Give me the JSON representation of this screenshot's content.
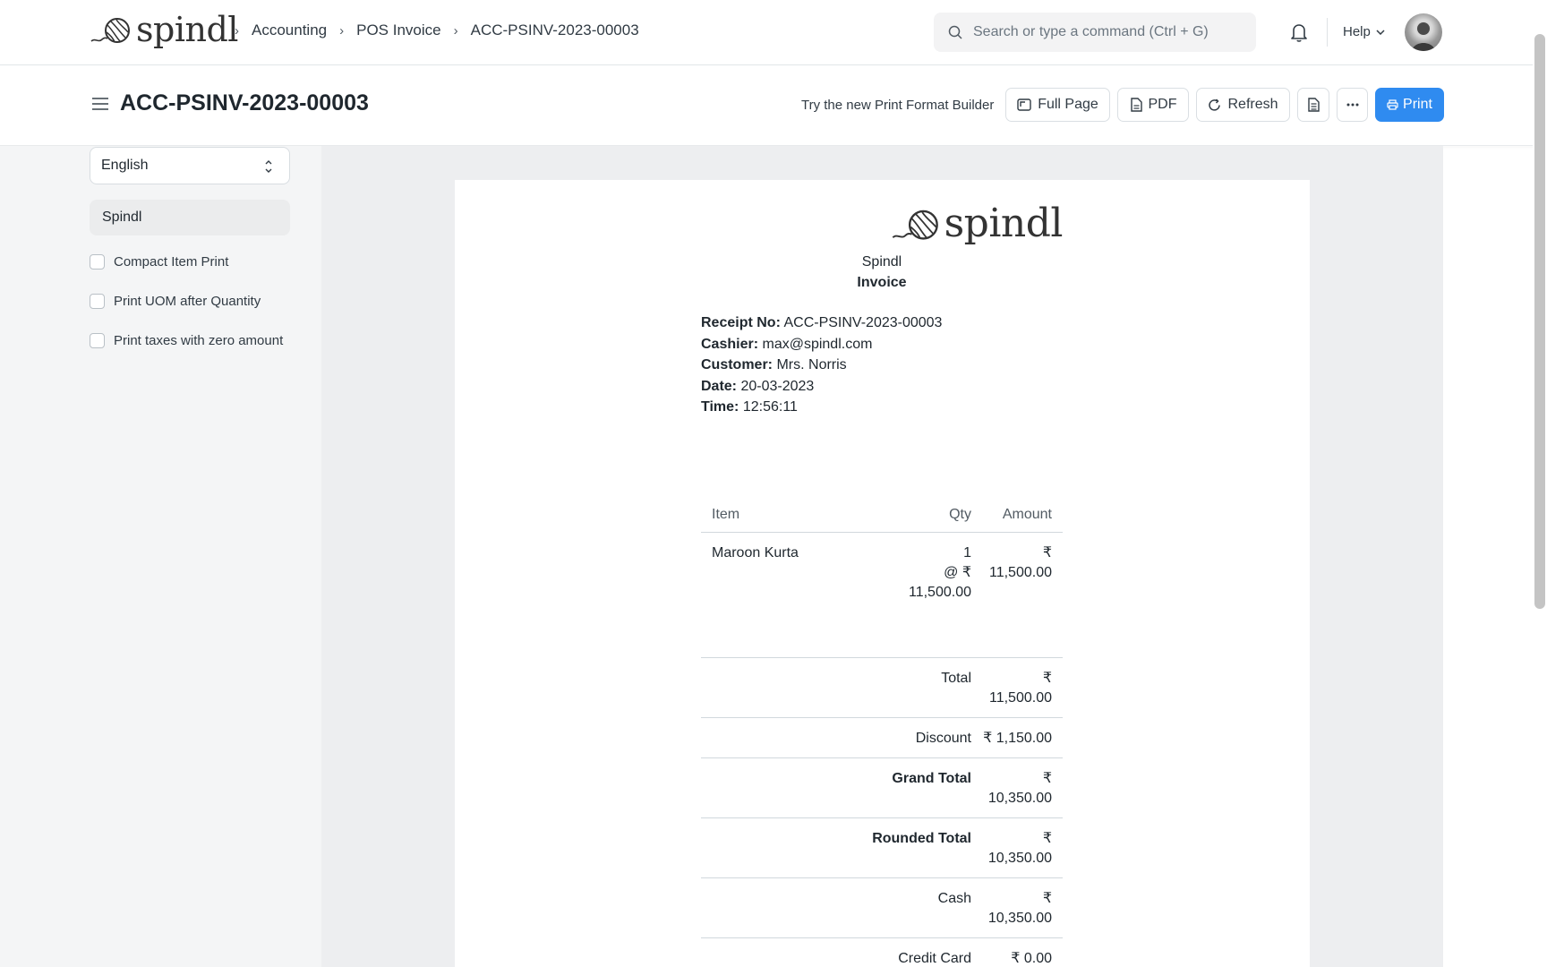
{
  "navbar": {
    "brand": "spindl",
    "breadcrumbs": [
      "Accounting",
      "POS Invoice",
      "ACC-PSINV-2023-00003"
    ],
    "search_placeholder": "Search or type a command (Ctrl + G)",
    "help_label": "Help"
  },
  "header": {
    "title": "ACC-PSINV-2023-00003",
    "builder_link": "Try the new Print Format Builder",
    "buttons": {
      "full_page": "Full Page",
      "pdf": "PDF",
      "refresh": "Refresh",
      "print": "Print"
    }
  },
  "sidebar": {
    "language": "English",
    "letterhead": "Spindl",
    "options": [
      {
        "label": "Compact Item Print",
        "checked": false
      },
      {
        "label": "Print UOM after Quantity",
        "checked": false
      },
      {
        "label": "Print taxes with zero amount",
        "checked": false
      }
    ]
  },
  "receipt": {
    "logo": "spindl",
    "company": "Spindl",
    "doc_type": "Invoice",
    "meta": [
      {
        "label": "Receipt No:",
        "value": "ACC-PSINV-2023-00003"
      },
      {
        "label": "Cashier:",
        "value": "max@spindl.com"
      },
      {
        "label": "Customer:",
        "value": "Mrs. Norris"
      },
      {
        "label": "Date:",
        "value": "20-03-2023"
      },
      {
        "label": "Time:",
        "value": "12:56:11"
      }
    ],
    "columns": {
      "item": "Item",
      "qty": "Qty",
      "amount": "Amount"
    },
    "items": [
      {
        "name": "Maroon Kurta",
        "qty": "1",
        "rate_line1": "@ ₹",
        "rate_line2": "11,500.00",
        "amount_line1": "₹",
        "amount_line2": "11,500.00"
      }
    ],
    "totals": [
      {
        "label": "Total",
        "line1": "₹",
        "line2": "11,500.00",
        "bold": false
      },
      {
        "label": "Discount",
        "line1": "₹ 1,150.00",
        "line2": "",
        "bold": false
      },
      {
        "label": "Grand Total",
        "line1": "₹",
        "line2": "10,350.00",
        "bold": true
      },
      {
        "label": "Rounded Total",
        "line1": "₹",
        "line2": "10,350.00",
        "bold": true
      },
      {
        "label": "Cash",
        "line1": "₹",
        "line2": "10,350.00",
        "bold": false
      },
      {
        "label": "Credit Card",
        "line1": "₹ 0.00",
        "line2": "",
        "bold": false
      }
    ]
  },
  "colors": {
    "primary": "#2f8bf0",
    "sidebar_bg": "#f4f5f6",
    "preview_bg": "#edeef0"
  }
}
